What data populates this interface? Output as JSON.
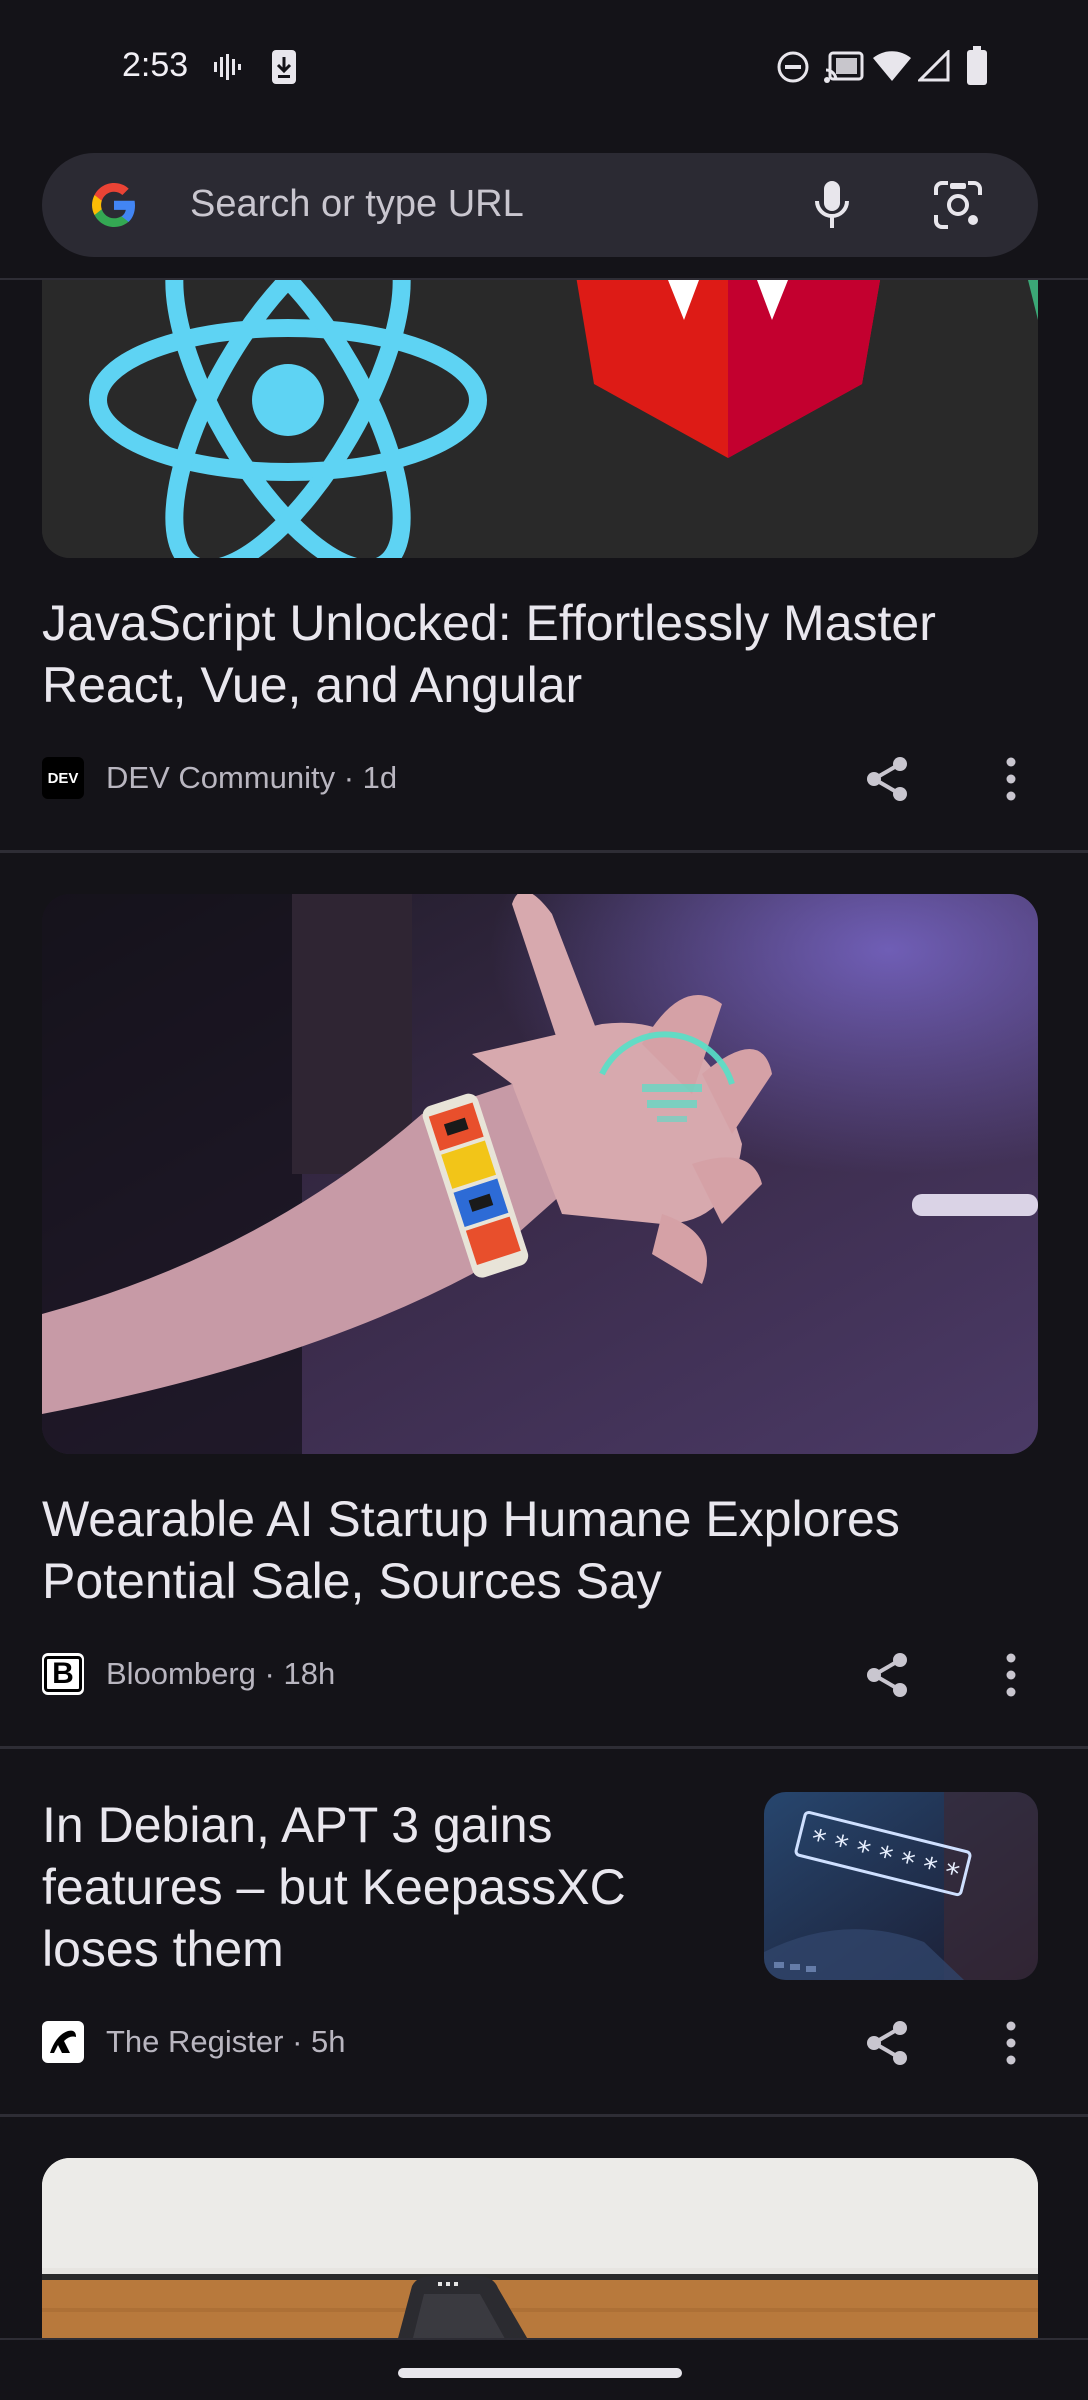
{
  "status_bar": {
    "time": "2:53",
    "icons": [
      "voicemail-icon",
      "download-icon",
      "do-not-disturb-icon",
      "cast-icon",
      "wifi-icon",
      "signal-icon",
      "battery-icon"
    ]
  },
  "search": {
    "placeholder": "Search or type URL",
    "icons": [
      "google-logo-icon",
      "mic-icon",
      "lens-icon"
    ]
  },
  "feed": {
    "cards": [
      {
        "headline": "JavaScript Unlocked: Effortlessly Master React, Vue, and Angular",
        "source": "DEV Community · 1d",
        "source_logo_text": "DEV",
        "image": "react-angular-logos"
      },
      {
        "headline": "Wearable AI Startup Humane Explores Potential Sale, Sources Say",
        "source": "Bloomberg · 18h",
        "source_logo_text": "B",
        "image": "hand-projection-photo"
      },
      {
        "headline": "In Debian, APT 3 gains features – but KeepassXC loses them",
        "source": "The Register · 5h",
        "source_logo_text": "",
        "image": "password-field-thumbnail"
      },
      {
        "headline": "",
        "source": "",
        "image": "phone-on-table-photo"
      }
    ]
  },
  "colors": {
    "background": "#141318",
    "search_bar": "#2b2a33",
    "react_blue": "#5ed3f3",
    "angular_red": "#dd1b16"
  }
}
